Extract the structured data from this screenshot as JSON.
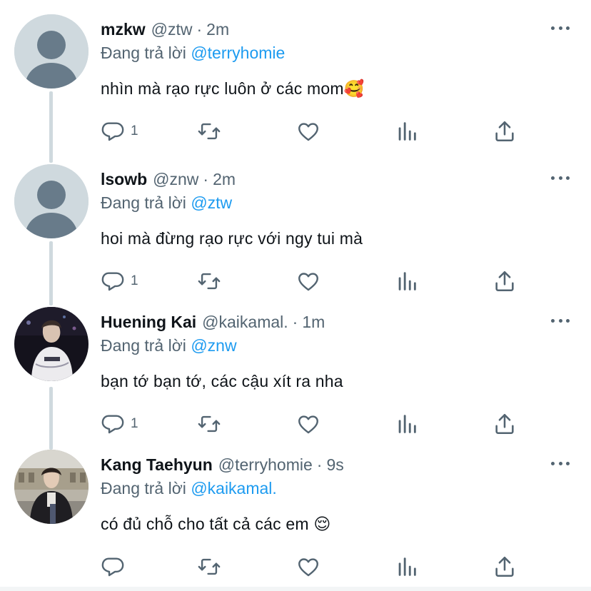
{
  "replying_prefix": "Đang trả lời",
  "tweets": [
    {
      "name": "mzkw",
      "handle": "@ztw",
      "dot": "·",
      "time": "2m",
      "replying_to": "@terryhomie",
      "text": "nhìn mà rạo rực luôn ở các mom🥰",
      "avatar": "default-avatar",
      "reply_count": "1"
    },
    {
      "name": "lsowb",
      "handle": "@znw",
      "dot": "·",
      "time": "2m",
      "replying_to": "@ztw",
      "text": "hoi mà đừng rạo rực với ngy tui mà",
      "avatar": "default-avatar",
      "reply_count": "1"
    },
    {
      "name": "Huening Kai",
      "handle": "@kaikamal.",
      "dot": "·",
      "time": "1m",
      "replying_to": "@znw",
      "text": "bạn tớ bạn tớ, các cậu xít ra nha",
      "avatar": "photo-avatar-dark",
      "reply_count": "1"
    },
    {
      "name": "Kang Taehyun",
      "handle": "@terryhomie",
      "dot": "·",
      "time": "9s",
      "replying_to": "@kaikamal.",
      "text": "có đủ chỗ cho tất cả các em 😌",
      "avatar": "photo-avatar-street",
      "reply_count": ""
    }
  ],
  "icons": {
    "reply": "reply-icon",
    "retweet": "retweet-icon",
    "like": "heart-icon",
    "views": "analytics-icon",
    "share": "share-icon",
    "more": "more-icon"
  },
  "colors": {
    "text": "#0f1419",
    "secondary": "#536471",
    "link": "#1d9bf0",
    "thread_line": "#cfd9de"
  }
}
